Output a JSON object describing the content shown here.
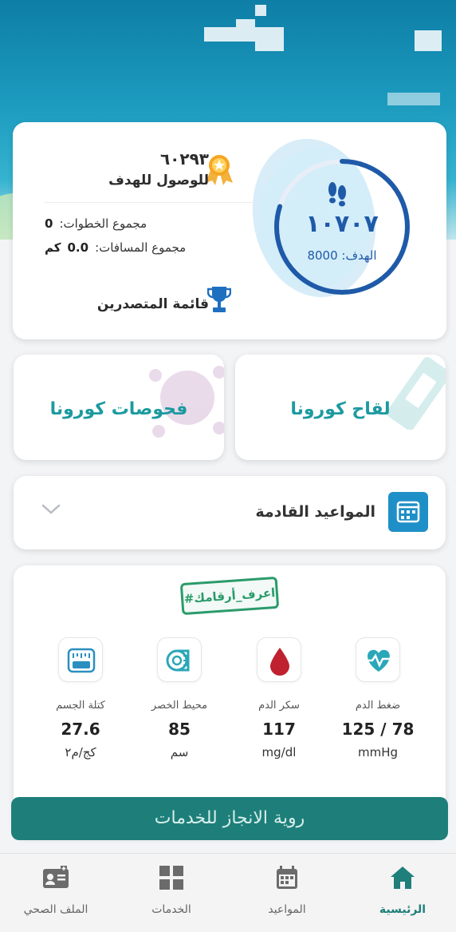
{
  "steps": {
    "count": "١٠٧٠٧",
    "goal_label": "الهدف:",
    "goal_value": "8000",
    "remaining": "٦٠٢٩٣",
    "remaining_label": "للوصول للهدف",
    "total_steps_label": "مجموع الخطوات:",
    "total_steps_value": "0",
    "total_distance_label": "مجموع المسافات:",
    "total_distance_value": "0.0",
    "distance_unit": "كم",
    "leaderboard_label": "قائمة المتصدرين",
    "progress": 0.8
  },
  "corona": {
    "vaccine_label": "لقاح كورونا",
    "tests_label": "فحوصات كورونا"
  },
  "appointments": {
    "label": "المواعيد القادمة"
  },
  "numbers": {
    "stamp": "#اعرف_أرقامك",
    "metrics": [
      {
        "name": "ضغط الدم",
        "value": "125 / 78",
        "unit": "mmHg"
      },
      {
        "name": "سكر الدم",
        "value": "117",
        "unit": "mg/dl"
      },
      {
        "name": "محيط الخصر",
        "value": "85",
        "unit": "سم"
      },
      {
        "name": "كتلة الجسم",
        "value": "27.6",
        "unit": "كج/م٢"
      }
    ]
  },
  "banner": {
    "label": "روية الانجاز للخدمات"
  },
  "nav": {
    "items": [
      {
        "label": "الرئيسية",
        "active": true
      },
      {
        "label": "المواعيد"
      },
      {
        "label": "الخدمات"
      },
      {
        "label": "الملف الصحي"
      }
    ]
  },
  "colors": {
    "accent": "#1f8fc7",
    "teal": "#1e7f7a",
    "ring": "#1e5aa8",
    "drop": "#c0212f"
  }
}
